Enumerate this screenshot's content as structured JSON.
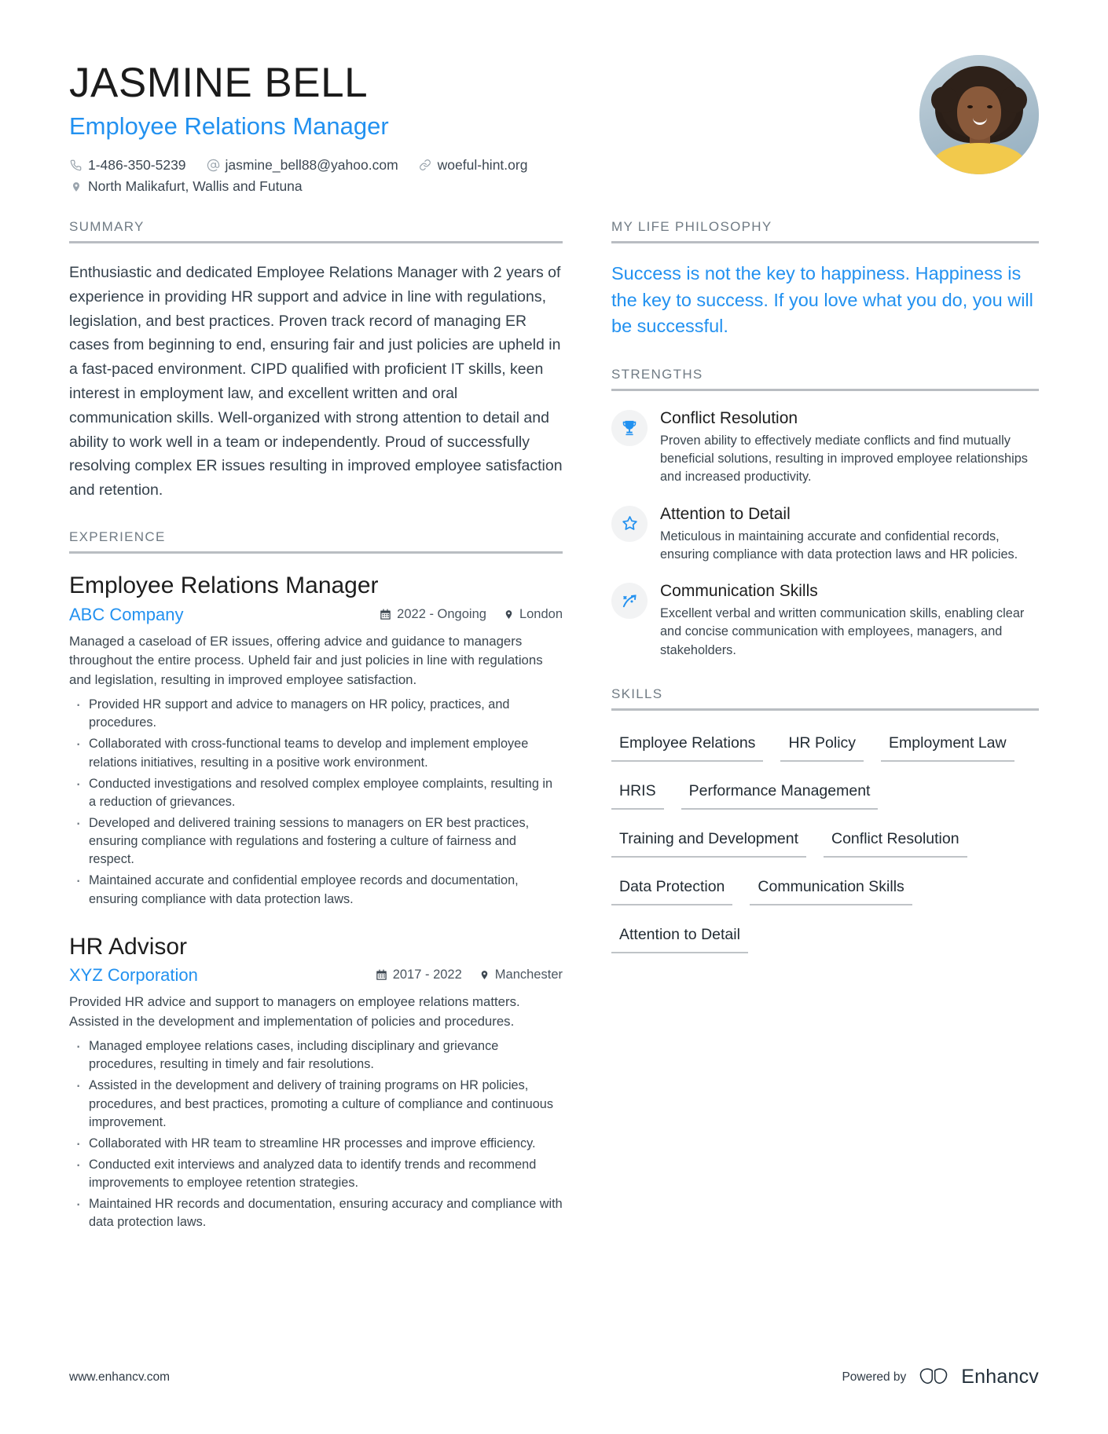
{
  "header": {
    "name": "JASMINE BELL",
    "job_title": "Employee Relations Manager",
    "phone": "1-486-350-5239",
    "email": "jasmine_bell88@yahoo.com",
    "website": "woeful-hint.org",
    "location": "North Malikafurt, Wallis and Futuna",
    "avatar_alt": "portrait-photo"
  },
  "colors": {
    "accent": "#2291f0",
    "heading_gray": "#707b84",
    "rule_gray": "#b9bdc2",
    "body_text": "#3b464f"
  },
  "summary": {
    "heading": "SUMMARY",
    "text": "Enthusiastic and dedicated Employee Relations Manager with 2 years of experience in providing HR support and advice in line with regulations, legislation, and best practices. Proven track record of managing ER cases from beginning to end, ensuring fair and just policies are upheld in a fast-paced environment. CIPD qualified with proficient IT skills, keen interest in employment law, and excellent written and oral communication skills. Well-organized with strong attention to detail and ability to work well in a team or independently. Proud of successfully resolving complex ER issues resulting in improved employee satisfaction and retention."
  },
  "experience": {
    "heading": "EXPERIENCE",
    "jobs": [
      {
        "role": "Employee Relations Manager",
        "company": "ABC Company",
        "dates": "2022 - Ongoing",
        "location": "London",
        "description": "Managed a caseload of ER issues, offering advice and guidance to managers throughout the entire process. Upheld fair and just policies in line with regulations and legislation, resulting in improved employee satisfaction.",
        "bullets": [
          "Provided HR support and advice to managers on HR policy, practices, and procedures.",
          "Collaborated with cross-functional teams to develop and implement employee relations initiatives, resulting in a positive work environment.",
          "Conducted investigations and resolved complex employee complaints, resulting in a reduction of grievances.",
          "Developed and delivered training sessions to managers on ER best practices, ensuring compliance with regulations and fostering a culture of fairness and respect.",
          "Maintained accurate and confidential employee records and documentation, ensuring compliance with data protection laws."
        ]
      },
      {
        "role": "HR Advisor",
        "company": "XYZ Corporation",
        "dates": "2017 - 2022",
        "location": "Manchester",
        "description": "Provided HR advice and support to managers on employee relations matters. Assisted in the development and implementation of policies and procedures.",
        "bullets": [
          "Managed employee relations cases, including disciplinary and grievance procedures, resulting in timely and fair resolutions.",
          "Assisted in the development and delivery of training programs on HR policies, procedures, and best practices, promoting a culture of compliance and continuous improvement.",
          "Collaborated with HR team to streamline HR processes and improve efficiency.",
          "Conducted exit interviews and analyzed data to identify trends and recommend improvements to employee retention strategies.",
          "Maintained HR records and documentation, ensuring accuracy and compliance with data protection laws."
        ]
      }
    ]
  },
  "philosophy": {
    "heading": "MY LIFE PHILOSOPHY",
    "quote": "Success is not the key to happiness. Happiness is the key to success. If you love what you do, you will be successful."
  },
  "strengths": {
    "heading": "STRENGTHS",
    "items": [
      {
        "icon": "trophy-icon",
        "title": "Conflict Resolution",
        "description": "Proven ability to effectively mediate conflicts and find mutually beneficial solutions, resulting in improved employee relationships and increased productivity."
      },
      {
        "icon": "star-icon",
        "title": "Attention to Detail",
        "description": "Meticulous in maintaining accurate and confidential records, ensuring compliance with data protection laws and HR policies."
      },
      {
        "icon": "growth-arrow-icon",
        "title": "Communication Skills",
        "description": "Excellent verbal and written communication skills, enabling clear and concise communication with employees, managers, and stakeholders."
      }
    ]
  },
  "skills": {
    "heading": "SKILLS",
    "items": [
      "Employee Relations",
      "HR Policy",
      "Employment Law",
      "HRIS",
      "Performance Management",
      "Training and Development",
      "Conflict Resolution",
      "Data Protection",
      "Communication Skills",
      "Attention to Detail"
    ]
  },
  "footer": {
    "site": "www.enhancv.com",
    "powered_by": "Powered by",
    "brand": "Enhancv"
  }
}
